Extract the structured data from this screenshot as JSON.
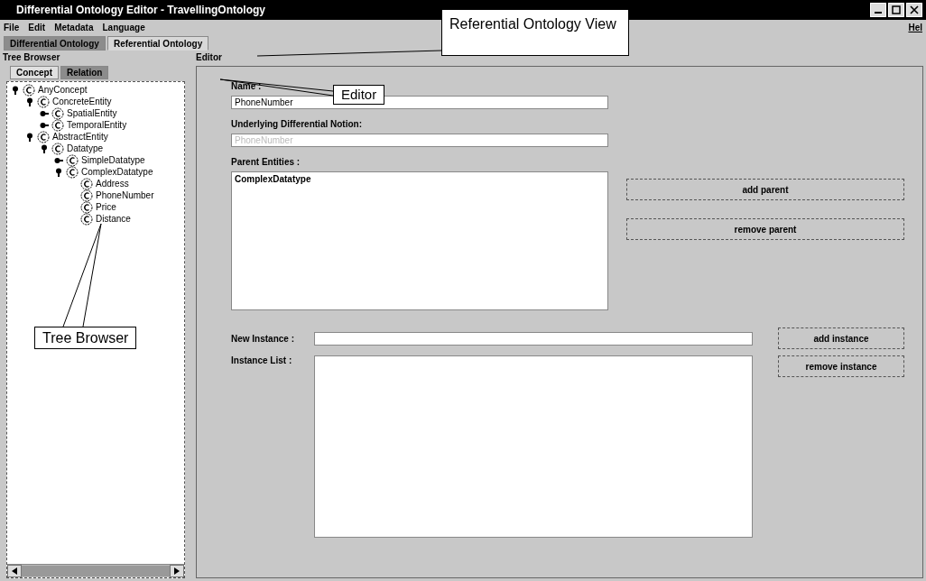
{
  "window": {
    "title": "Differential Ontology Editor - TravellingOntology"
  },
  "menu": [
    {
      "label": "File"
    },
    {
      "label": "Edit"
    },
    {
      "label": "Metadata"
    },
    {
      "label": "Language"
    }
  ],
  "menu_right": "Hel",
  "view_tabs": [
    {
      "label": "Differential Ontology",
      "selected": false
    },
    {
      "label": "Referential Ontology",
      "selected": true
    }
  ],
  "tree_browser": {
    "title": "Tree Browser",
    "tabs": [
      {
        "label": "Concept",
        "selected": true
      },
      {
        "label": "Relation",
        "selected": false
      }
    ],
    "tree": [
      {
        "label": "AnyConcept",
        "expanded": true,
        "children": [
          {
            "label": "ConcreteEntity",
            "expanded": true,
            "children": [
              {
                "label": "SpatialEntity",
                "expanded": false
              },
              {
                "label": "TemporalEntity",
                "expanded": false
              }
            ]
          },
          {
            "label": "AbstractEntity",
            "expanded": true,
            "children": [
              {
                "label": "Datatype",
                "expanded": true,
                "children": [
                  {
                    "label": "SimpleDatatype",
                    "expanded": false
                  },
                  {
                    "label": "ComplexDatatype",
                    "expanded": true,
                    "children": [
                      {
                        "label": "Address"
                      },
                      {
                        "label": "PhoneNumber"
                      },
                      {
                        "label": "Price"
                      },
                      {
                        "label": "Distance"
                      }
                    ]
                  }
                ]
              }
            ]
          }
        ]
      }
    ]
  },
  "editor": {
    "title": "Editor",
    "name_label": "Name :",
    "name_value": "PhoneNumber",
    "notion_label": "Underlying Differential Notion:",
    "notion_value": "PhoneNumber",
    "notion_disabled": true,
    "parents_label": "Parent Entities :",
    "parents": [
      "ComplexDatatype"
    ],
    "add_parent": "add parent",
    "remove_parent": "remove parent",
    "new_instance_label": "New Instance :",
    "add_instance": "add instance",
    "instance_list_label": "Instance List :",
    "remove_instance": "remove instance"
  },
  "callouts": [
    {
      "text": "Referential Ontology View",
      "kind": "view"
    },
    {
      "text": "Editor",
      "kind": "editor"
    },
    {
      "text": "Tree Browser",
      "kind": "tree"
    }
  ]
}
